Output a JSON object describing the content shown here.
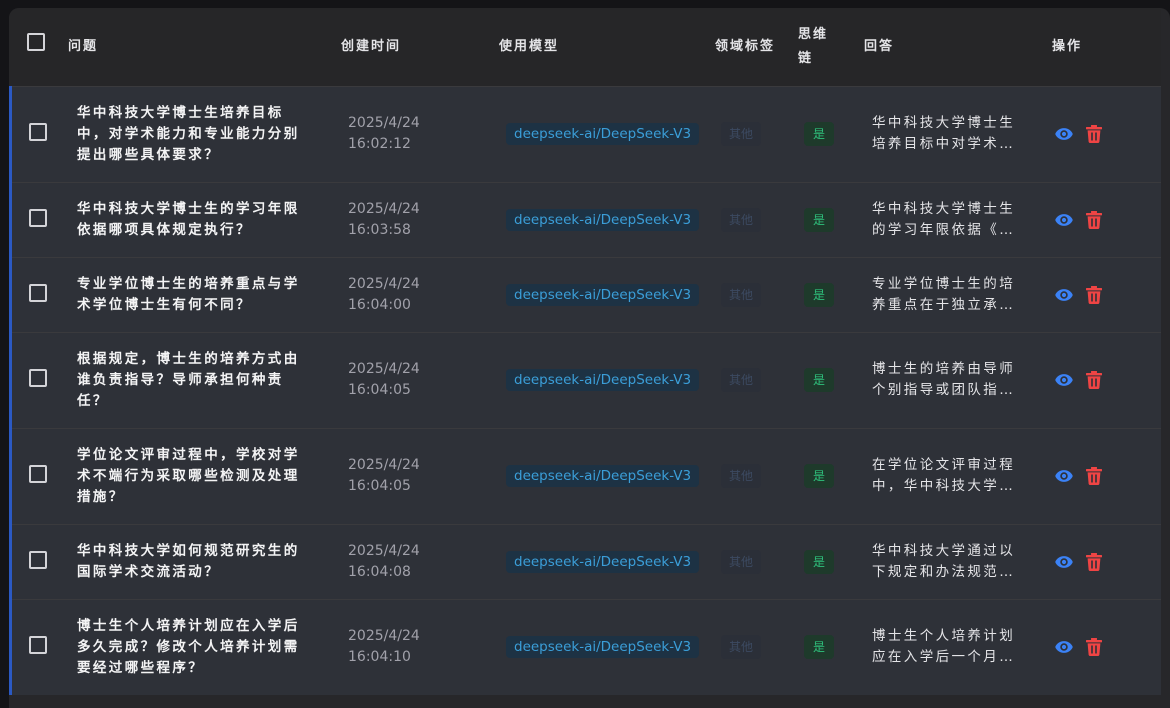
{
  "header": {
    "question": "问题",
    "created": "创建时间",
    "model": "使用模型",
    "domain": "领域标签",
    "cot": "思维链",
    "answer": "回答",
    "actions": "操作"
  },
  "rows": [
    {
      "q1": "华中科技大学博士生培养目标",
      "q2": "中，对学术能力和专业能力分别",
      "q3": "提出哪些具体要求？",
      "date": "2025/4/24",
      "time": "16:02:12",
      "model": "deepseek-ai/DeepSeek-V3",
      "domain": "其他",
      "cot": "是",
      "a1": "华中科技大学博士生",
      "a2": "培养目标中对学术…"
    },
    {
      "q1": "华中科技大学博士生的学习年限",
      "q2": "依据哪项具体规定执行？",
      "date": "2025/4/24",
      "time": "16:03:58",
      "model": "deepseek-ai/DeepSeek-V3",
      "domain": "其他",
      "cot": "是",
      "a1": "华中科技大学博士生",
      "a2": "的学习年限依据《…"
    },
    {
      "q1": "专业学位博士生的培养重点与学",
      "q2": "术学位博士生有何不同？",
      "date": "2025/4/24",
      "time": "16:04:00",
      "model": "deepseek-ai/DeepSeek-V3",
      "domain": "其他",
      "cot": "是",
      "a1": "专业学位博士生的培",
      "a2": "养重点在于独立承…"
    },
    {
      "q1": "根据规定，博士生的培养方式由",
      "q2": "谁负责指导？导师承担何种责",
      "q3": "任？",
      "date": "2025/4/24",
      "time": "16:04:05",
      "model": "deepseek-ai/DeepSeek-V3",
      "domain": "其他",
      "cot": "是",
      "a1": "博士生的培养由导师",
      "a2": "个别指导或团队指…"
    },
    {
      "q1": "学位论文评审过程中，学校对学",
      "q2": "术不端行为采取哪些检测及处理",
      "q3": "措施？",
      "date": "2025/4/24",
      "time": "16:04:05",
      "model": "deepseek-ai/DeepSeek-V3",
      "domain": "其他",
      "cot": "是",
      "a1": "在学位论文评审过程",
      "a2": "中，华中科技大学…"
    },
    {
      "q1": "华中科技大学如何规范研究生的",
      "q2": "国际学术交流活动？",
      "date": "2025/4/24",
      "time": "16:04:08",
      "model": "deepseek-ai/DeepSeek-V3",
      "domain": "其他",
      "cot": "是",
      "a1": "华中科技大学通过以",
      "a2": "下规定和办法规范…"
    },
    {
      "q1": "博士生个人培养计划应在入学后",
      "q2": "多久完成？修改个人培养计划需",
      "q3": "要经过哪些程序？",
      "date": "2025/4/24",
      "time": "16:04:10",
      "model": "deepseek-ai/DeepSeek-V3",
      "domain": "其他",
      "cot": "是",
      "a1": "博士生个人培养计划",
      "a2": "应在入学后一个月…"
    }
  ],
  "icons": {
    "view": "eye-icon",
    "delete": "trash-icon"
  },
  "colors": {
    "accent": "#2b59c3",
    "view": "#3b82f6",
    "delete": "#ef4444",
    "cot": "#2fc17c",
    "model": "#3b9ed8"
  }
}
